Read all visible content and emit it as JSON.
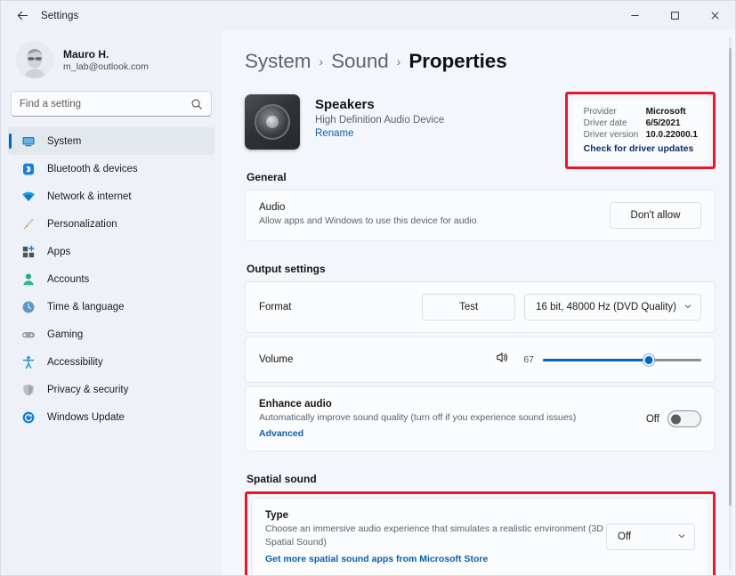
{
  "window": {
    "title": "Settings",
    "back_icon": "back-arrow-icon",
    "minimize_label": "–",
    "maximize_label": "☐",
    "close_label": "✕"
  },
  "sidebar": {
    "account": {
      "name": "Mauro H.",
      "email": "m_lab@outlook.com",
      "avatar_icon": "user-avatar-icon"
    },
    "search": {
      "placeholder": "Find a setting",
      "icon": "search-icon",
      "value": ""
    },
    "items": [
      {
        "label": "System",
        "icon": "monitor-icon",
        "active": true
      },
      {
        "label": "Bluetooth & devices",
        "icon": "bluetooth-icon",
        "active": false
      },
      {
        "label": "Network & internet",
        "icon": "wifi-icon",
        "active": false
      },
      {
        "label": "Personalization",
        "icon": "paintbrush-icon",
        "active": false
      },
      {
        "label": "Apps",
        "icon": "apps-grid-icon",
        "active": false
      },
      {
        "label": "Accounts",
        "icon": "person-icon",
        "active": false
      },
      {
        "label": "Time & language",
        "icon": "clock-globe-icon",
        "active": false
      },
      {
        "label": "Gaming",
        "icon": "gamepad-icon",
        "active": false
      },
      {
        "label": "Accessibility",
        "icon": "accessibility-person-icon",
        "active": false
      },
      {
        "label": "Privacy & security",
        "icon": "shield-icon",
        "active": false
      },
      {
        "label": "Windows Update",
        "icon": "update-refresh-icon",
        "active": false
      }
    ]
  },
  "main": {
    "breadcrumb": {
      "root": "System",
      "sep1": "›",
      "middle": "Sound",
      "sep2": "›",
      "current": "Properties"
    },
    "device": {
      "icon": "speaker-icon",
      "name": "Speakers",
      "description": "High Definition Audio Device",
      "rename_label": "Rename"
    },
    "driver": {
      "provider_label": "Provider",
      "provider_value": "Microsoft",
      "date_label": "Driver date",
      "date_value": "6/5/2021",
      "version_label": "Driver version",
      "version_value": "10.0.22000.1",
      "check_updates_label": "Check for driver updates",
      "highlight_color": "#e8172a"
    },
    "general": {
      "heading": "General",
      "audio": {
        "title": "Audio",
        "subtitle": "Allow apps and Windows to use this device for audio",
        "button_label": "Don't allow"
      }
    },
    "output": {
      "heading": "Output settings",
      "format": {
        "title": "Format",
        "test_label": "Test",
        "selected": "16 bit, 48000 Hz (DVD Quality)",
        "chevron": "⌄"
      },
      "volume": {
        "title": "Volume",
        "speaker_icon": "volume-speaker-icon",
        "value": 67,
        "min": 0,
        "max": 100
      },
      "enhance": {
        "title": "Enhance audio",
        "subtitle": "Automatically improve sound quality (turn off if you experience sound issues)",
        "link_label": "Advanced",
        "toggle_label": "Off",
        "toggle_on": false
      }
    },
    "spatial": {
      "heading": "Spatial sound",
      "type": {
        "title": "Type",
        "subtitle": "Choose an immersive audio experience that simulates a realistic environment (3D Spatial Sound)",
        "link_label": "Get more spatial sound apps from Microsoft Store",
        "selected": "Off",
        "chevron": "⌄"
      },
      "highlight_color": "#e8172a"
    }
  },
  "colors": {
    "accent": "#0067c0",
    "link": "#0a5fae",
    "highlight": "#e8172a",
    "sidebar_bg": "#eef2f8",
    "main_bg": "#f3f6fb"
  }
}
